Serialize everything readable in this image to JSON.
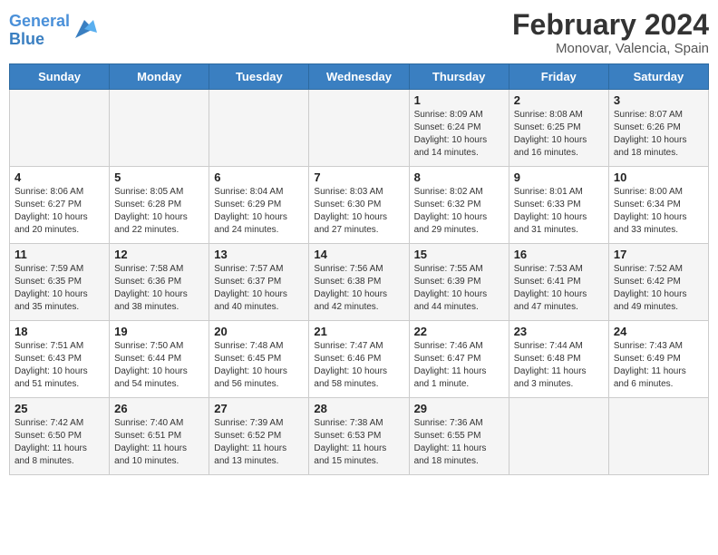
{
  "header": {
    "logo_line1": "General",
    "logo_line2": "Blue",
    "title": "February 2024",
    "subtitle": "Monovar, Valencia, Spain"
  },
  "days_of_week": [
    "Sunday",
    "Monday",
    "Tuesday",
    "Wednesday",
    "Thursday",
    "Friday",
    "Saturday"
  ],
  "weeks": [
    [
      {
        "day": "",
        "info": ""
      },
      {
        "day": "",
        "info": ""
      },
      {
        "day": "",
        "info": ""
      },
      {
        "day": "",
        "info": ""
      },
      {
        "day": "1",
        "info": "Sunrise: 8:09 AM\nSunset: 6:24 PM\nDaylight: 10 hours and 14 minutes."
      },
      {
        "day": "2",
        "info": "Sunrise: 8:08 AM\nSunset: 6:25 PM\nDaylight: 10 hours and 16 minutes."
      },
      {
        "day": "3",
        "info": "Sunrise: 8:07 AM\nSunset: 6:26 PM\nDaylight: 10 hours and 18 minutes."
      }
    ],
    [
      {
        "day": "4",
        "info": "Sunrise: 8:06 AM\nSunset: 6:27 PM\nDaylight: 10 hours and 20 minutes."
      },
      {
        "day": "5",
        "info": "Sunrise: 8:05 AM\nSunset: 6:28 PM\nDaylight: 10 hours and 22 minutes."
      },
      {
        "day": "6",
        "info": "Sunrise: 8:04 AM\nSunset: 6:29 PM\nDaylight: 10 hours and 24 minutes."
      },
      {
        "day": "7",
        "info": "Sunrise: 8:03 AM\nSunset: 6:30 PM\nDaylight: 10 hours and 27 minutes."
      },
      {
        "day": "8",
        "info": "Sunrise: 8:02 AM\nSunset: 6:32 PM\nDaylight: 10 hours and 29 minutes."
      },
      {
        "day": "9",
        "info": "Sunrise: 8:01 AM\nSunset: 6:33 PM\nDaylight: 10 hours and 31 minutes."
      },
      {
        "day": "10",
        "info": "Sunrise: 8:00 AM\nSunset: 6:34 PM\nDaylight: 10 hours and 33 minutes."
      }
    ],
    [
      {
        "day": "11",
        "info": "Sunrise: 7:59 AM\nSunset: 6:35 PM\nDaylight: 10 hours and 35 minutes."
      },
      {
        "day": "12",
        "info": "Sunrise: 7:58 AM\nSunset: 6:36 PM\nDaylight: 10 hours and 38 minutes."
      },
      {
        "day": "13",
        "info": "Sunrise: 7:57 AM\nSunset: 6:37 PM\nDaylight: 10 hours and 40 minutes."
      },
      {
        "day": "14",
        "info": "Sunrise: 7:56 AM\nSunset: 6:38 PM\nDaylight: 10 hours and 42 minutes."
      },
      {
        "day": "15",
        "info": "Sunrise: 7:55 AM\nSunset: 6:39 PM\nDaylight: 10 hours and 44 minutes."
      },
      {
        "day": "16",
        "info": "Sunrise: 7:53 AM\nSunset: 6:41 PM\nDaylight: 10 hours and 47 minutes."
      },
      {
        "day": "17",
        "info": "Sunrise: 7:52 AM\nSunset: 6:42 PM\nDaylight: 10 hours and 49 minutes."
      }
    ],
    [
      {
        "day": "18",
        "info": "Sunrise: 7:51 AM\nSunset: 6:43 PM\nDaylight: 10 hours and 51 minutes."
      },
      {
        "day": "19",
        "info": "Sunrise: 7:50 AM\nSunset: 6:44 PM\nDaylight: 10 hours and 54 minutes."
      },
      {
        "day": "20",
        "info": "Sunrise: 7:48 AM\nSunset: 6:45 PM\nDaylight: 10 hours and 56 minutes."
      },
      {
        "day": "21",
        "info": "Sunrise: 7:47 AM\nSunset: 6:46 PM\nDaylight: 10 hours and 58 minutes."
      },
      {
        "day": "22",
        "info": "Sunrise: 7:46 AM\nSunset: 6:47 PM\nDaylight: 11 hours and 1 minute."
      },
      {
        "day": "23",
        "info": "Sunrise: 7:44 AM\nSunset: 6:48 PM\nDaylight: 11 hours and 3 minutes."
      },
      {
        "day": "24",
        "info": "Sunrise: 7:43 AM\nSunset: 6:49 PM\nDaylight: 11 hours and 6 minutes."
      }
    ],
    [
      {
        "day": "25",
        "info": "Sunrise: 7:42 AM\nSunset: 6:50 PM\nDaylight: 11 hours and 8 minutes."
      },
      {
        "day": "26",
        "info": "Sunrise: 7:40 AM\nSunset: 6:51 PM\nDaylight: 11 hours and 10 minutes."
      },
      {
        "day": "27",
        "info": "Sunrise: 7:39 AM\nSunset: 6:52 PM\nDaylight: 11 hours and 13 minutes."
      },
      {
        "day": "28",
        "info": "Sunrise: 7:38 AM\nSunset: 6:53 PM\nDaylight: 11 hours and 15 minutes."
      },
      {
        "day": "29",
        "info": "Sunrise: 7:36 AM\nSunset: 6:55 PM\nDaylight: 11 hours and 18 minutes."
      },
      {
        "day": "",
        "info": ""
      },
      {
        "day": "",
        "info": ""
      }
    ]
  ]
}
